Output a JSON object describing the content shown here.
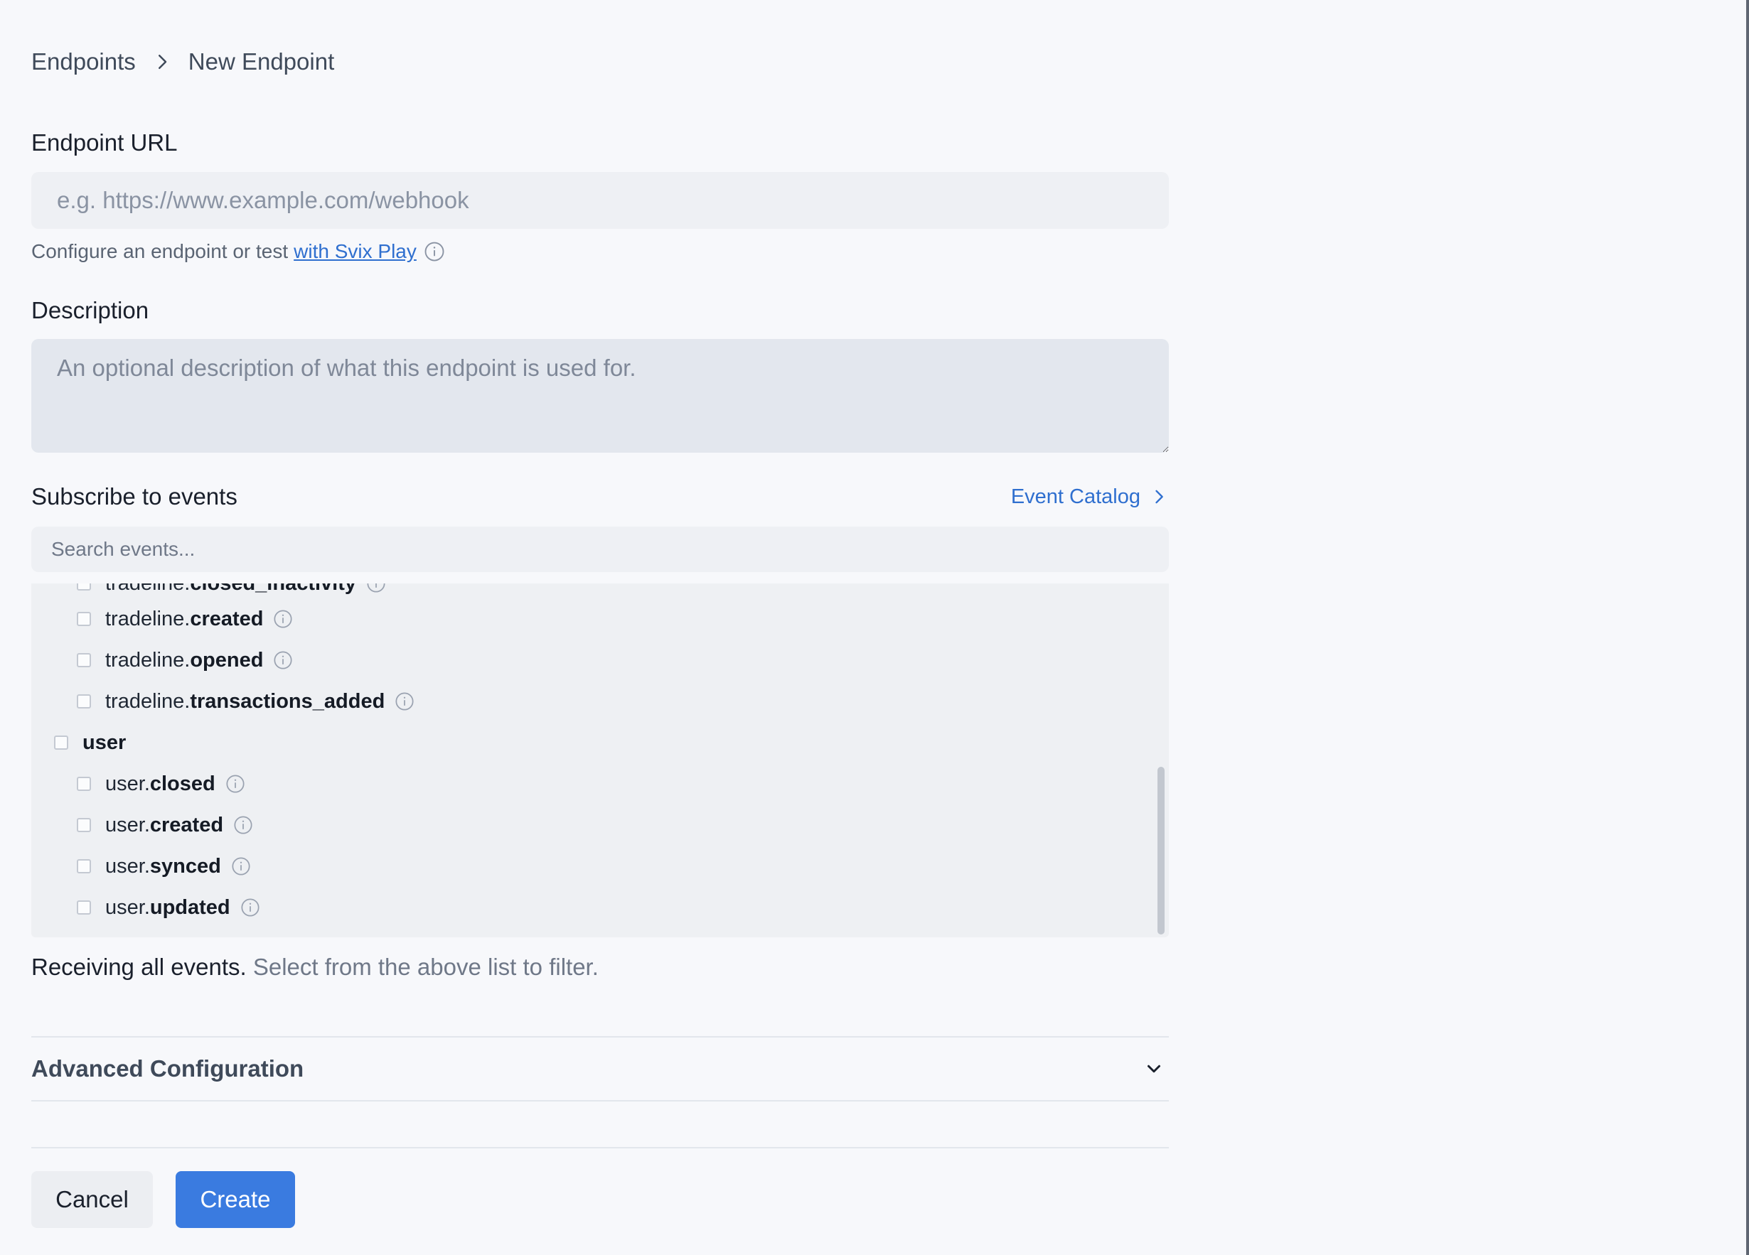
{
  "breadcrumb": {
    "parent": "Endpoints",
    "current": "New Endpoint"
  },
  "url_field": {
    "label": "Endpoint URL",
    "placeholder": "e.g. https://www.example.com/webhook",
    "value": ""
  },
  "helper": {
    "text": "Configure an endpoint or test",
    "link": "with Svix Play"
  },
  "description_field": {
    "label": "Description",
    "placeholder": "An optional description of what this endpoint is used for.",
    "value": ""
  },
  "subscribe": {
    "title": "Subscribe to events",
    "catalog_link": "Event Catalog"
  },
  "search": {
    "placeholder": "Search events..."
  },
  "events": {
    "partial": {
      "prefix": "tradeline.",
      "name": "closed_inactivity"
    },
    "tradeline_created": {
      "prefix": "tradeline.",
      "name": "created"
    },
    "tradeline_opened": {
      "prefix": "tradeline.",
      "name": "opened"
    },
    "tradeline_transactions_added": {
      "prefix": "tradeline.",
      "name": "transactions_added"
    },
    "user_group": {
      "name": "user"
    },
    "user_closed": {
      "prefix": "user.",
      "name": "closed"
    },
    "user_created": {
      "prefix": "user.",
      "name": "created"
    },
    "user_synced": {
      "prefix": "user.",
      "name": "synced"
    },
    "user_updated": {
      "prefix": "user.",
      "name": "updated"
    }
  },
  "receiving": {
    "strong": "Receiving all events.",
    "muted": "Select from the above list to filter."
  },
  "advanced": {
    "title": "Advanced Configuration"
  },
  "buttons": {
    "cancel": "Cancel",
    "create": "Create"
  },
  "colors": {
    "accent": "#3a7be0",
    "link": "#2f6fcf"
  }
}
